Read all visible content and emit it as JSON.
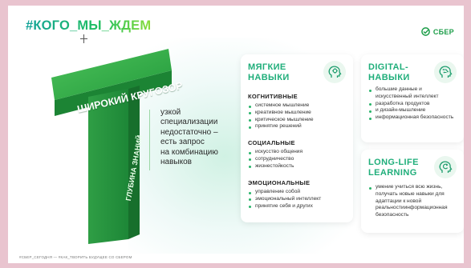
{
  "title": "#КОГО_МЫ_ЖДЕМ",
  "logo": {
    "text": "СБЕР"
  },
  "t_shape": {
    "top_label": "ШИРОКИЙ КРУГОЗОР",
    "stem_label": "ГЛУБИНА ЗНАНИЙ"
  },
  "description": {
    "lines": [
      "узкой",
      "специализации",
      "недостаточно –",
      "есть запрос",
      "на комбинацию",
      "навыков"
    ]
  },
  "soft_skills": {
    "title_lines": [
      "МЯГКИЕ",
      "НАВЫКИ"
    ],
    "icon": "head-gear-icon",
    "sections": [
      {
        "head": "КОГНИТИВНЫЕ",
        "items": [
          "системное мышление",
          "креативное мышление",
          "критическое мышление",
          "принятие решений"
        ]
      },
      {
        "head": "СОЦИАЛЬНЫЕ",
        "items": [
          "искусство общения",
          "сотрудничество",
          "жизнестойкость"
        ]
      },
      {
        "head": "ЭМОЦИОНАЛЬНЫЕ",
        "items": [
          "управление собой",
          "эмоциональный интеллект",
          "принятие себя и других"
        ]
      }
    ]
  },
  "digital_skills": {
    "title_lines": [
      "DIGITAL-",
      "НАВЫКИ"
    ],
    "icon": "head-circuit-icon",
    "items": [
      "большие данные и искусственный интеллект",
      "разработка продуктов",
      "и дизайн-мышление",
      "информационная безопасность"
    ]
  },
  "long_life": {
    "title_lines": [
      "LONG-LIFE",
      "LEARNING"
    ],
    "icon": "head-refresh-icon",
    "items": [
      "умение учиться всю жизнь, получать новые навыки для адаптации к новой реальностиинформационная безопасность"
    ]
  },
  "footer": "#СБЕР_СЕГОДНЯ  —  #КАК_ТВОРИТЬ БУДУЩЕЕ СО СБЕРОМ",
  "colors": {
    "accent": "#1fae7a",
    "green": "#28b46a",
    "t_green": "#2ea84a",
    "bg": "#e9c4cf"
  }
}
